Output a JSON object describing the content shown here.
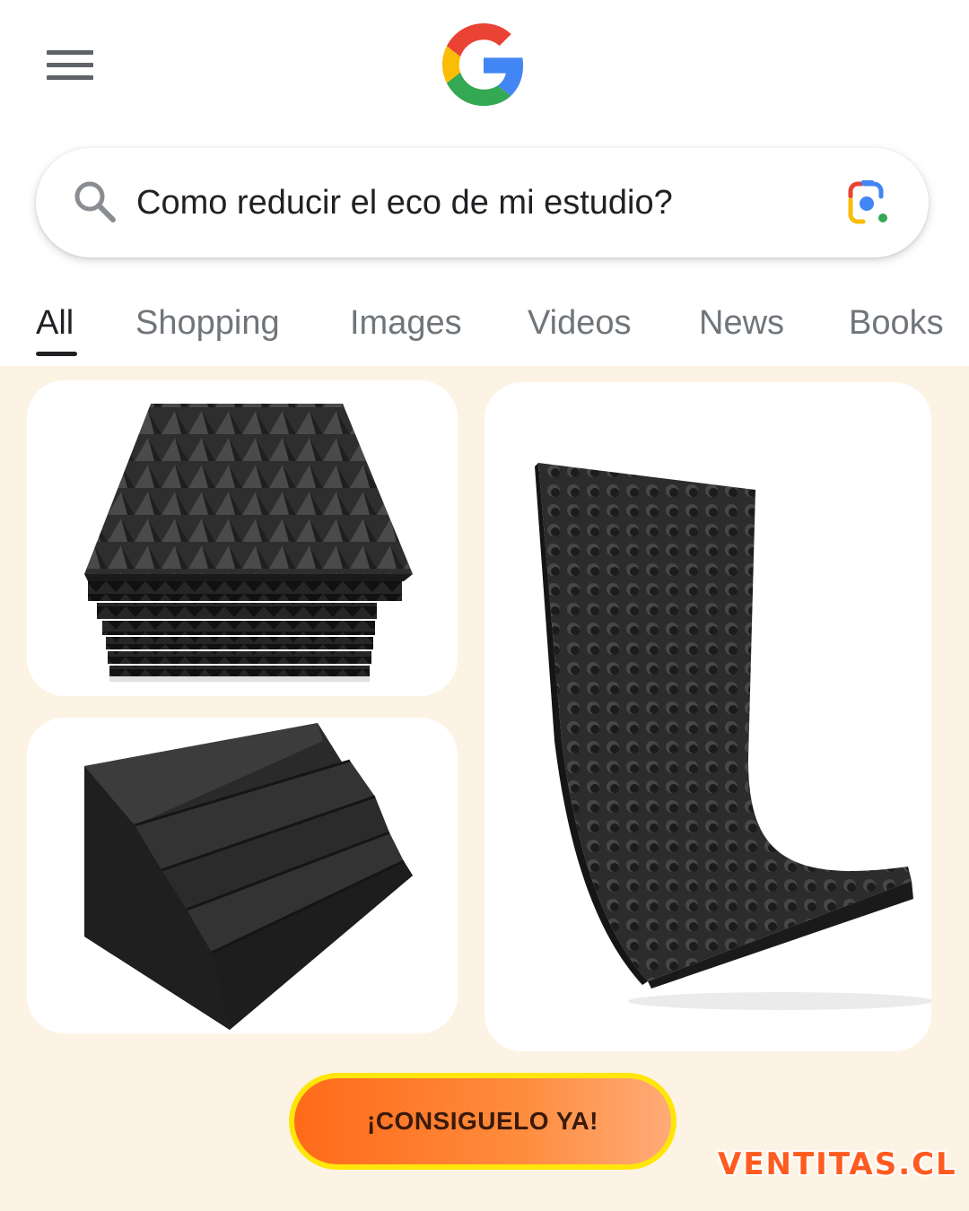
{
  "header": {
    "menu_icon": "hamburger-menu-icon",
    "logo": "google-g-logo",
    "logo_colors": [
      "#4285F4",
      "#EA4335",
      "#FBBC05",
      "#34A853"
    ]
  },
  "search": {
    "query": "Como reducir el eco de mi estudio?",
    "left_icon": "search-icon",
    "right_icon": "google-lens-icon"
  },
  "tabs": [
    {
      "label": "All",
      "active": true
    },
    {
      "label": "Shopping",
      "active": false
    },
    {
      "label": "Images",
      "active": false
    },
    {
      "label": "Videos",
      "active": false
    },
    {
      "label": "News",
      "active": false
    },
    {
      "label": "Books",
      "active": false
    }
  ],
  "results": [
    {
      "image": "pyramid-acoustic-foam-panels-stack"
    },
    {
      "image": "acoustic-foam-bass-trap-wedge"
    },
    {
      "image": "egg-crate-acoustic-foam-sheet"
    }
  ],
  "cta": {
    "label": "¡CONSIGUELO YA!"
  },
  "brand": {
    "label": "VENTITAS.CL",
    "color": "#ff5a1f"
  },
  "colors": {
    "background": "#fdf3e4",
    "cta_border": "#ffe60a",
    "cta_fill": "#ff6a1a"
  }
}
